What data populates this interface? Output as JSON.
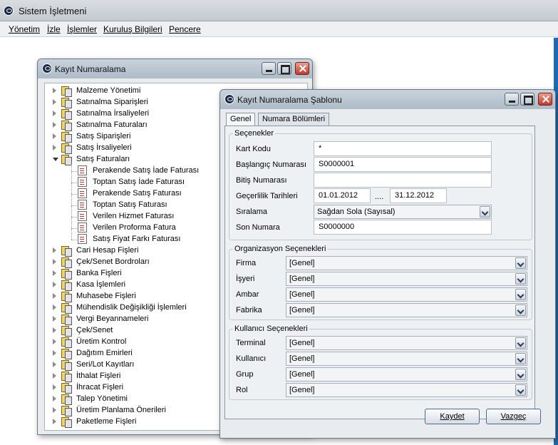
{
  "app": {
    "title": "Sistem İşletmeni",
    "menu": [
      "Yönetim",
      "İzle",
      "İşlemler",
      "Kuruluş Bilgileri",
      "Pencere"
    ]
  },
  "tree_window": {
    "title": "Kayıt Numaralama",
    "items": [
      "Malzeme Yönetimi",
      "Satınalma Siparişleri",
      "Satınalma İrsaliyeleri",
      "Satınalma Faturaları",
      "Satış Siparişleri",
      "Satış İrsaliyeleri",
      "Satış Faturaları"
    ],
    "sub_items": [
      "Perakende Satış İade Faturası",
      "Toptan Satış İade Faturası",
      "Perakende Satış Faturası",
      "Toptan Satış Faturası",
      "Verilen Hizmet Faturası",
      "Verilen Proforma Fatura",
      "Satış Fiyat Farkı Faturası"
    ],
    "items_after": [
      "Cari Hesap Fişleri",
      "Çek/Senet Bordroları",
      "Banka Fişleri",
      "Kasa İşlemleri",
      "Muhasebe Fişleri",
      "Mühendislik Değişikliği İşlemleri",
      "Vergi Beyannameleri",
      "Çek/Senet",
      "Üretim Kontrol",
      "Dağıtım Emirleri",
      "Seri/Lot Kayıtları",
      "İthalat Fişleri",
      "İhracat Fişleri",
      "Talep Yönetimi",
      "Üretim Planlama Önerileri",
      "Paketleme Fişleri"
    ]
  },
  "dialog": {
    "title": "Kayıt Numaralama Şablonu",
    "tabs": [
      "Genel",
      "Numara Bölümleri"
    ],
    "options_group": {
      "title": "Seçenekler",
      "kart_kodu_label": "Kart Kodu",
      "kart_kodu_value": "*",
      "baslangic_label": "Başlangıç Numarası",
      "baslangic_value": "S0000001",
      "bitis_label": "Bitiş Numarası",
      "bitis_value": "",
      "gecerlilik_label": "Geçerlilik Tarihleri",
      "date_from": "01.01.2012",
      "date_sep": "....",
      "date_to": "31.12.2012",
      "siralama_label": "Sıralama",
      "siralama_value": "Sağdan Sola (Sayısal)",
      "son_numara_label": "Son Numara",
      "son_numara_value": "S0000000"
    },
    "org_group": {
      "title": "Organizasyon Seçenekleri",
      "rows": [
        {
          "label": "Firma",
          "value": "[Genel]"
        },
        {
          "label": "İşyeri",
          "value": "[Genel]"
        },
        {
          "label": "Ambar",
          "value": "[Genel]"
        },
        {
          "label": "Fabrika",
          "value": "[Genel]"
        }
      ]
    },
    "user_group": {
      "title": "Kullanıcı Seçenekleri",
      "rows": [
        {
          "label": "Terminal",
          "value": "[Genel]"
        },
        {
          "label": "Kullanıcı",
          "value": "[Genel]"
        },
        {
          "label": "Grup",
          "value": "[Genel]"
        },
        {
          "label": "Rol",
          "value": "[Genel]"
        }
      ]
    },
    "save_label": "Kaydet",
    "cancel_label": "Vazgeç"
  }
}
